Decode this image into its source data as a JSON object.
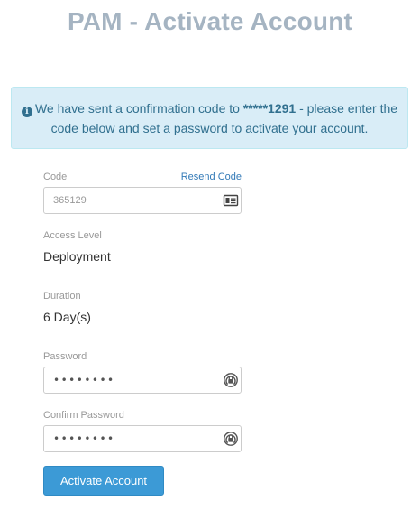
{
  "page": {
    "title": "PAM - Activate Account"
  },
  "alert": {
    "text_before": "We have sent a confirmation code to ",
    "masked_number": "*****1291",
    "text_after": " - please enter the code below and set a password to activate your account."
  },
  "form": {
    "code_label": "Code",
    "resend_label": "Resend Code",
    "code_value": "365129",
    "access_level_label": "Access Level",
    "access_level_value": "Deployment",
    "duration_label": "Duration",
    "duration_value": "6 Day(s)",
    "password_label": "Password",
    "password_dots": "••••••••",
    "confirm_password_label": "Confirm Password",
    "confirm_password_dots": "••••••••",
    "submit_label": "Activate Account"
  },
  "icons": {
    "code_field_icon": "id-card-icon",
    "password_field_icon": "password-manager-icon",
    "info": "info-circle-icon"
  },
  "colors": {
    "title": "#a5b4c2",
    "alert_bg": "#d9edf7",
    "alert_text": "#31708f",
    "link": "#337ab7",
    "button": "#3c9ad6"
  }
}
